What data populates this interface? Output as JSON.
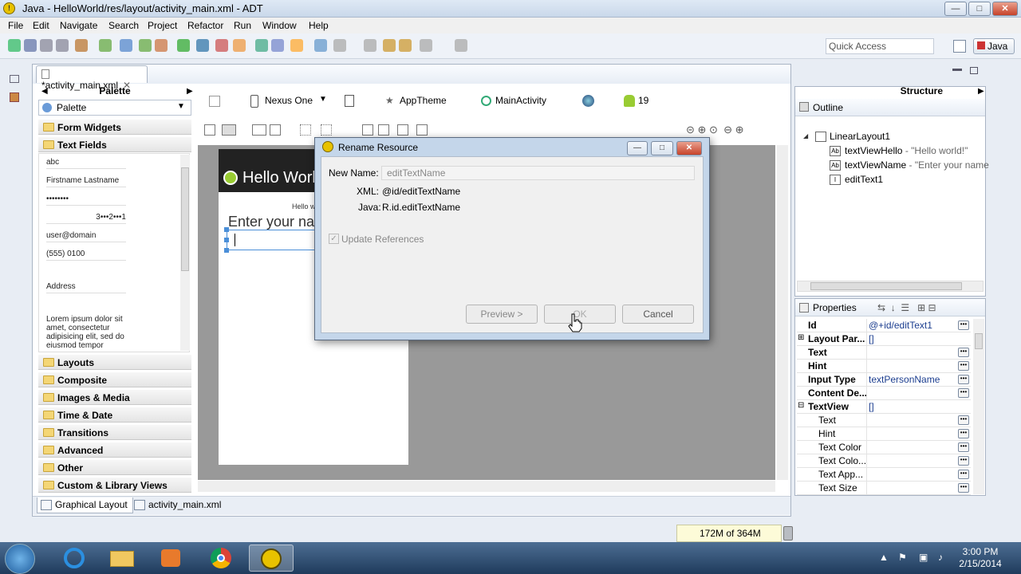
{
  "window": {
    "title": "Java - HelloWorld/res/layout/activity_main.xml - ADT",
    "minimize": "—",
    "maximize": "□",
    "close": "✕"
  },
  "menu": [
    "File",
    "Edit",
    "Navigate",
    "Search",
    "Project",
    "Refactor",
    "Run",
    "Window",
    "Help"
  ],
  "toolbar": {
    "quick_access_placeholder": "Quick Access",
    "perspective": "Java"
  },
  "editor": {
    "tab_label": "*activity_main.xml",
    "bottom_tabs": [
      "Graphical Layout",
      "activity_main.xml"
    ]
  },
  "palette": {
    "header": "Palette",
    "combo": "Palette",
    "categories_top": [
      "Form Widgets",
      "Text Fields"
    ],
    "text_fields": [
      "abc",
      "Firstname Lastname",
      "••••••••",
      "3•••2•••1",
      "user@domain",
      "(555) 0100",
      "Address",
      "Lorem ipsum dolor sit amet, consectetur adipisicing elit, sed do eiusmod tempor"
    ],
    "categories_bottom": [
      "Layouts",
      "Composite",
      "Images & Media",
      "Time & Date",
      "Transitions",
      "Advanced",
      "Other",
      "Custom & Library Views"
    ]
  },
  "canvas_toolbar": {
    "device": "Nexus One",
    "theme": "AppTheme",
    "activity": "MainActivity",
    "api": "19"
  },
  "device_preview": {
    "app_title": "Hello World",
    "hello_text": "Hello w",
    "enter_text": "Enter your na"
  },
  "dialog": {
    "title": "Rename Resource",
    "new_name_label": "New Name:",
    "new_name_value": "editTextName",
    "xml_label": "XML:",
    "xml_value": "@id/editTextName",
    "java_label": "Java:",
    "java_value": "R.id.editTextName",
    "update_refs": "Update References",
    "preview_btn": "Preview >",
    "ok_btn": "OK",
    "cancel_btn": "Cancel"
  },
  "structure": {
    "header": "Structure",
    "outline": "Outline",
    "nodes": [
      {
        "name": "LinearLayout1",
        "detail": ""
      },
      {
        "name": "textViewHello",
        "detail": " - \"Hello world!\""
      },
      {
        "name": "textViewName",
        "detail": " - \"Enter your name"
      },
      {
        "name": "editText1",
        "detail": ""
      }
    ]
  },
  "properties": {
    "header": "Properties",
    "rows": [
      {
        "key": "Id",
        "value": "@+id/editText1",
        "dots": true,
        "sub": false,
        "expander": ""
      },
      {
        "key": "Layout Par...",
        "value": "[]",
        "dots": false,
        "sub": false,
        "expander": "⊞"
      },
      {
        "key": "Text",
        "value": "",
        "dots": true,
        "sub": false,
        "expander": ""
      },
      {
        "key": "Hint",
        "value": "",
        "dots": true,
        "sub": false,
        "expander": ""
      },
      {
        "key": "Input Type",
        "value": "textPersonName",
        "dots": true,
        "sub": false,
        "expander": ""
      },
      {
        "key": "Content De...",
        "value": "",
        "dots": true,
        "sub": false,
        "expander": ""
      },
      {
        "key": "TextView",
        "value": "[]",
        "dots": false,
        "sub": false,
        "expander": "⊟"
      },
      {
        "key": "Text",
        "value": "",
        "dots": true,
        "sub": true,
        "expander": ""
      },
      {
        "key": "Hint",
        "value": "",
        "dots": true,
        "sub": true,
        "expander": ""
      },
      {
        "key": "Text Color",
        "value": "",
        "dots": true,
        "sub": true,
        "expander": ""
      },
      {
        "key": "Text Colo...",
        "value": "",
        "dots": true,
        "sub": true,
        "expander": ""
      },
      {
        "key": "Text App...",
        "value": "",
        "dots": true,
        "sub": true,
        "expander": ""
      },
      {
        "key": "Text Size",
        "value": "",
        "dots": true,
        "sub": true,
        "expander": ""
      }
    ]
  },
  "status": {
    "memory": "172M of 364M",
    "memory_used_fraction": 0.47
  },
  "taskbar": {
    "time": "3:00 PM",
    "date": "2/15/2014"
  }
}
